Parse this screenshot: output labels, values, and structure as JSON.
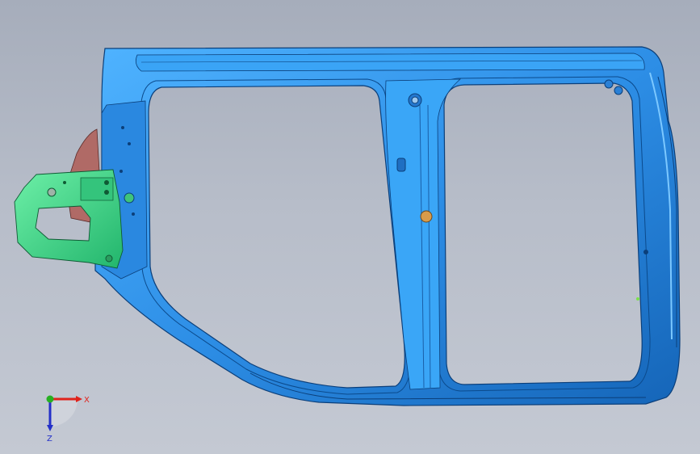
{
  "triad": {
    "x_label": "X",
    "z_label": "Z",
    "x_color": "#e0231c",
    "y_color": "#27b022",
    "z_color": "#2430c8"
  },
  "colors": {
    "background_top": "#a6adbb",
    "background_bottom": "#c4c9d3",
    "panel_main": "#2d8ee6",
    "panel_light": "#4fb3ff",
    "panel_dark": "#1565b8",
    "bracket_green": "#3fd38a",
    "bracket_red": "#b06a66"
  },
  "icons": [
    "coordinate-triad-icon"
  ]
}
